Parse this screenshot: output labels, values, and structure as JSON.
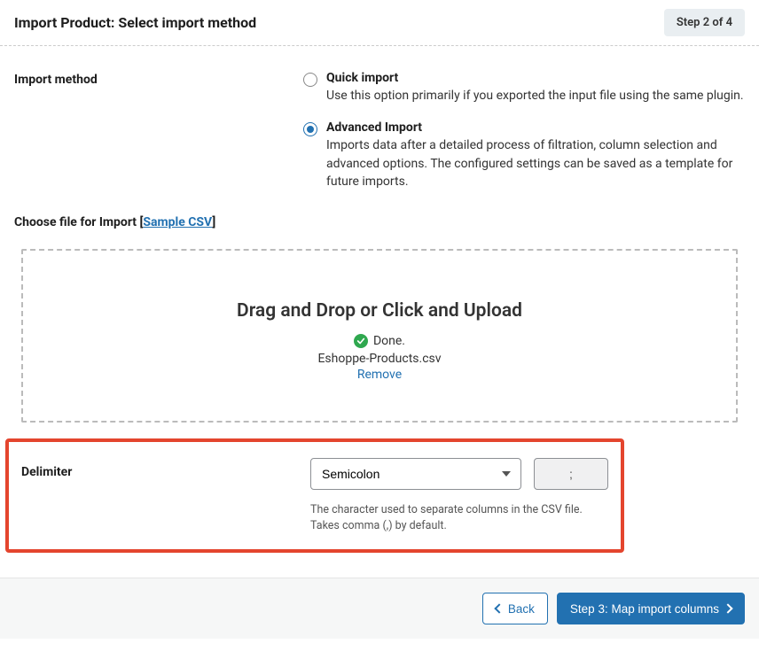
{
  "header": {
    "title": "Import Product: Select import method",
    "step_badge": "Step 2 of 4"
  },
  "import_method": {
    "label": "Import method",
    "options": [
      {
        "title": "Quick import",
        "desc": "Use this option primarily if you exported the input file using the same plugin.",
        "selected": false
      },
      {
        "title": "Advanced Import",
        "desc": "Imports data after a detailed process of filtration, column selection and advanced options. The configured settings can be saved as a template for future imports.",
        "selected": true
      }
    ]
  },
  "file_section": {
    "label_prefix": "Choose file for Import [",
    "sample_link": "Sample CSV",
    "label_suffix": "]",
    "dropzone_title": "Drag and Drop or Click and Upload",
    "done_text": "Done.",
    "filename": "Eshoppe-Products.csv",
    "remove_text": "Remove"
  },
  "delimiter": {
    "label": "Delimiter",
    "selected": "Semicolon",
    "char": ";",
    "help": "The character used to separate columns in the CSV file. Takes comma (,) by default."
  },
  "footer": {
    "back": "Back",
    "next": "Step 3: Map import columns"
  }
}
